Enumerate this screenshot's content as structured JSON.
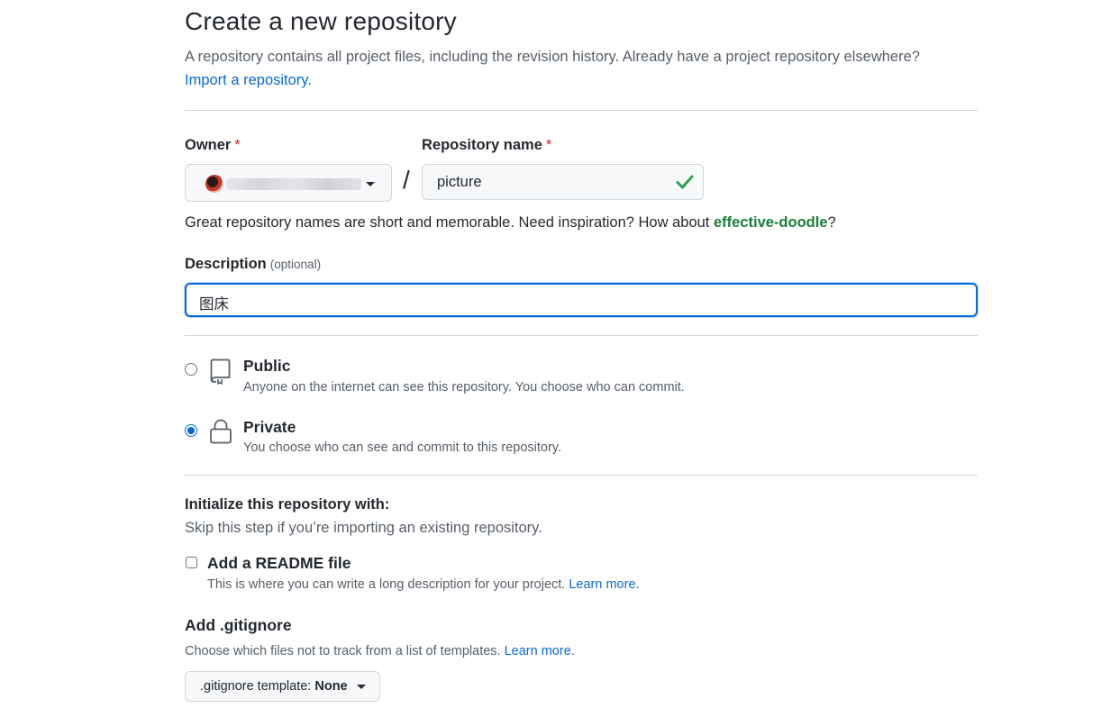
{
  "header": {
    "title": "Create a new repository",
    "subtitle": "A repository contains all project files, including the revision history. Already have a project repository elsewhere?",
    "import_link": "Import a repository."
  },
  "owner": {
    "label": "Owner",
    "required_mark": "*"
  },
  "repo_name": {
    "label": "Repository name",
    "required_mark": "*",
    "value": "picture",
    "separator": "/"
  },
  "name_hint": {
    "text": "Great repository names are short and memorable. Need inspiration? How about ",
    "suggestion": "effective-doodle",
    "suffix": "?"
  },
  "description": {
    "label": "Description",
    "optional": "(optional)",
    "value": "图床"
  },
  "visibility": {
    "selected": "Private",
    "options": [
      {
        "title": "Public",
        "desc": "Anyone on the internet can see this repository. You choose who can commit.",
        "icon": "repo-icon"
      },
      {
        "title": "Private",
        "desc": "You choose who can see and commit to this repository.",
        "icon": "lock-icon"
      }
    ]
  },
  "initialize": {
    "title": "Initialize this repository with:",
    "subtitle": "Skip this step if you’re importing an existing repository.",
    "readme": {
      "label": "Add a README file",
      "checked": false,
      "desc": "This is where you can write a long description for your project.",
      "link": "Learn more."
    }
  },
  "gitignore": {
    "title": "Add .gitignore",
    "desc": "Choose which files not to track from a list of templates.",
    "link": "Learn more.",
    "button_prefix": ".gitignore template:",
    "button_value": "None"
  },
  "colors": {
    "accent": "#0969da",
    "success": "#1a7f37",
    "danger": "#cf222e",
    "muted": "#57606a"
  }
}
